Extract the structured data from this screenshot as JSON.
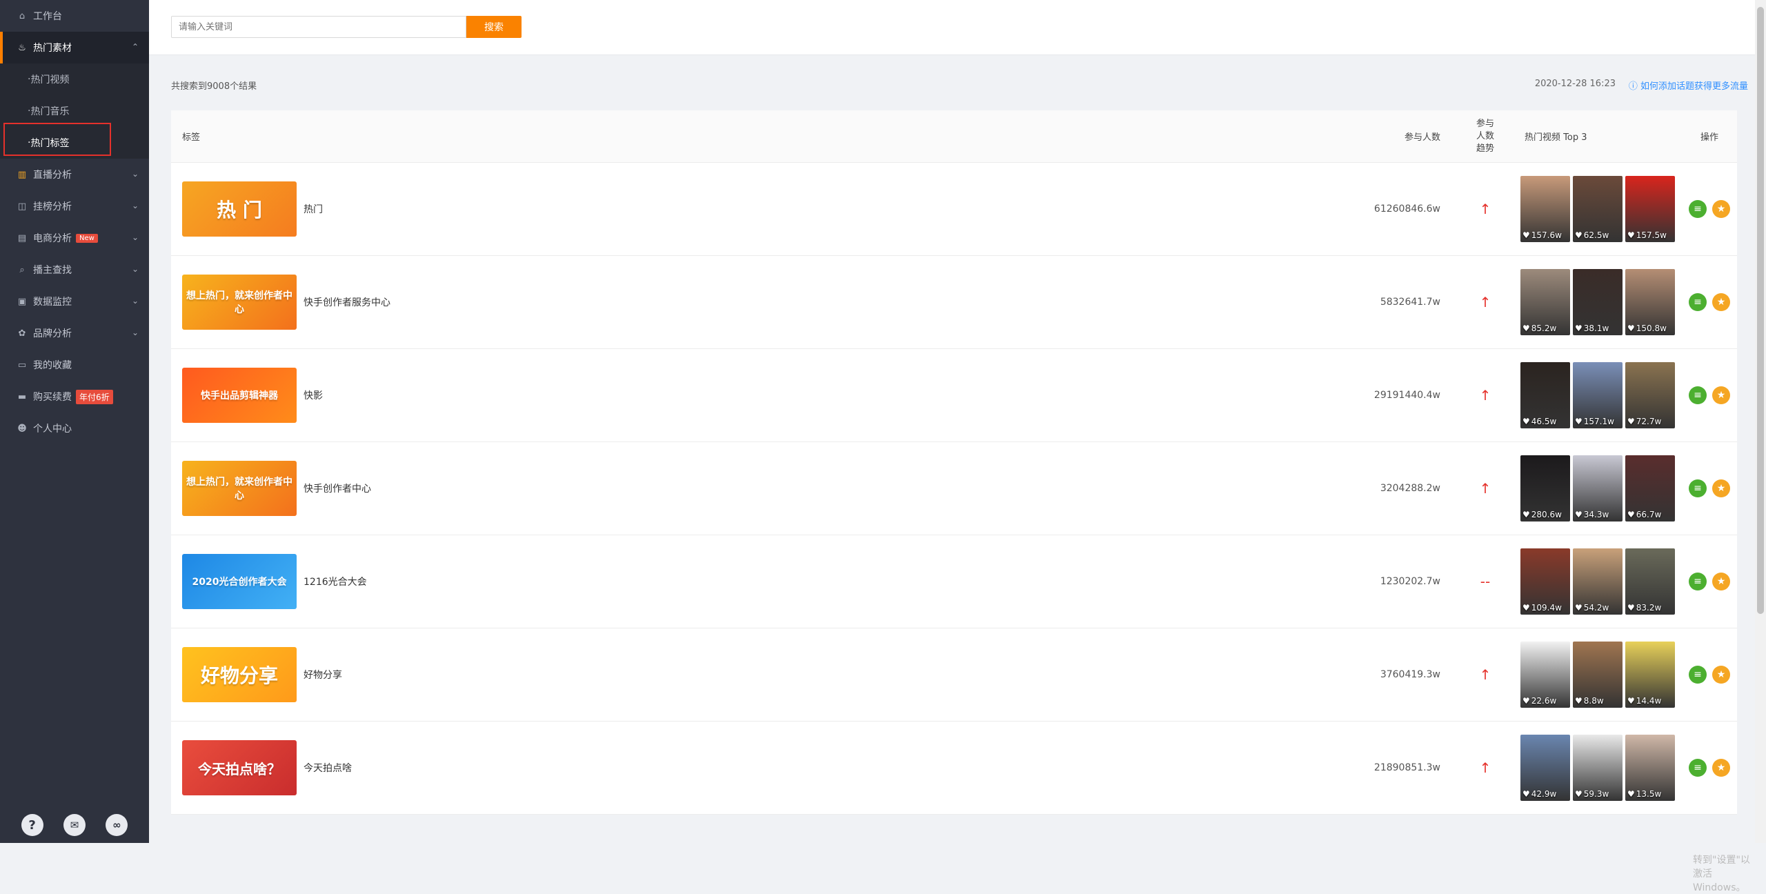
{
  "sidebar": {
    "items": [
      {
        "label": "工作台",
        "icon": "home-icon"
      },
      {
        "label": "热门素材",
        "icon": "fire-icon"
      },
      {
        "label": "热门视频"
      },
      {
        "label": "热门音乐"
      },
      {
        "label": "热门标签"
      },
      {
        "label": "直播分析",
        "icon": "bar-chart-icon"
      },
      {
        "label": "挂榜分析",
        "icon": "trend-icon"
      },
      {
        "label": "电商分析",
        "icon": "shop-icon",
        "badge": "New"
      },
      {
        "label": "播主查找",
        "icon": "search-icon"
      },
      {
        "label": "数据监控",
        "icon": "monitor-icon"
      },
      {
        "label": "品牌分析",
        "icon": "brand-icon"
      },
      {
        "label": "我的收藏",
        "icon": "collection-icon"
      },
      {
        "label": "购买续费",
        "icon": "card-icon",
        "badge": "年付6折"
      },
      {
        "label": "个人中心",
        "icon": "user-icon"
      }
    ],
    "bottom_icons": [
      "help-icon",
      "wechat-icon",
      "link-icon"
    ]
  },
  "search": {
    "placeholder": "请输入关键词",
    "button": "搜索"
  },
  "summary": {
    "result_count": "共搜索到9008个结果",
    "date": "2020-12-28 16:23",
    "help_link": "如何添加话题获得更多流量"
  },
  "table": {
    "headers": {
      "tag": "标签",
      "participants": "参与人数",
      "trend": "参与人数趋势",
      "top_videos": "热门视频 Top 3",
      "ops": "操作"
    },
    "rows": [
      {
        "banner_text": "热 门",
        "banner_colors": [
          "#f6a623",
          "#f57c1f"
        ],
        "name": "热门",
        "participants": "61260846.6w",
        "trend": "↑",
        "likes": [
          "157.6w",
          "62.5w",
          "157.5w"
        ]
      },
      {
        "banner_text": "想上热门，就来创作者中心",
        "banner_colors": [
          "#f7b31d",
          "#f3701c"
        ],
        "name": "快手创作者服务中心",
        "participants": "5832641.7w",
        "trend": "↑",
        "likes": [
          "85.2w",
          "38.1w",
          "150.8w"
        ]
      },
      {
        "banner_text": "快手出品剪辑神器",
        "banner_colors": [
          "#ff5a1f",
          "#ff8c1a"
        ],
        "name": "快影",
        "participants": "29191440.4w",
        "trend": "↑",
        "likes": [
          "46.5w",
          "157.1w",
          "72.7w"
        ]
      },
      {
        "banner_text": "想上热门，就来创作者中心",
        "banner_colors": [
          "#f7b31d",
          "#f3701c"
        ],
        "name": "快手创作者中心",
        "participants": "3204288.2w",
        "trend": "↑",
        "likes": [
          "280.6w",
          "34.3w",
          "66.7w"
        ]
      },
      {
        "banner_text": "2020光合创作者大会",
        "banner_colors": [
          "#1e88e5",
          "#42b0f5"
        ],
        "name": "1216光合大会",
        "participants": "1230202.7w",
        "trend": "--",
        "likes": [
          "109.4w",
          "54.2w",
          "83.2w"
        ]
      },
      {
        "banner_text": "好物分享",
        "banner_colors": [
          "#ffc21f",
          "#ff9a1a"
        ],
        "name": "好物分享",
        "participants": "3760419.3w",
        "trend": "↑",
        "likes": [
          "22.6w",
          "8.8w",
          "14.4w"
        ]
      },
      {
        "banner_text": "今天拍点啥？",
        "banner_colors": [
          "#e94d3d",
          "#c92d2d"
        ],
        "name": "今天拍点啥",
        "participants": "21890851.3w",
        "trend": "↑",
        "likes": [
          "42.9w",
          "59.3w",
          "13.5w"
        ]
      }
    ]
  },
  "watermark": "转到\"设置\"以激活 Windows。"
}
